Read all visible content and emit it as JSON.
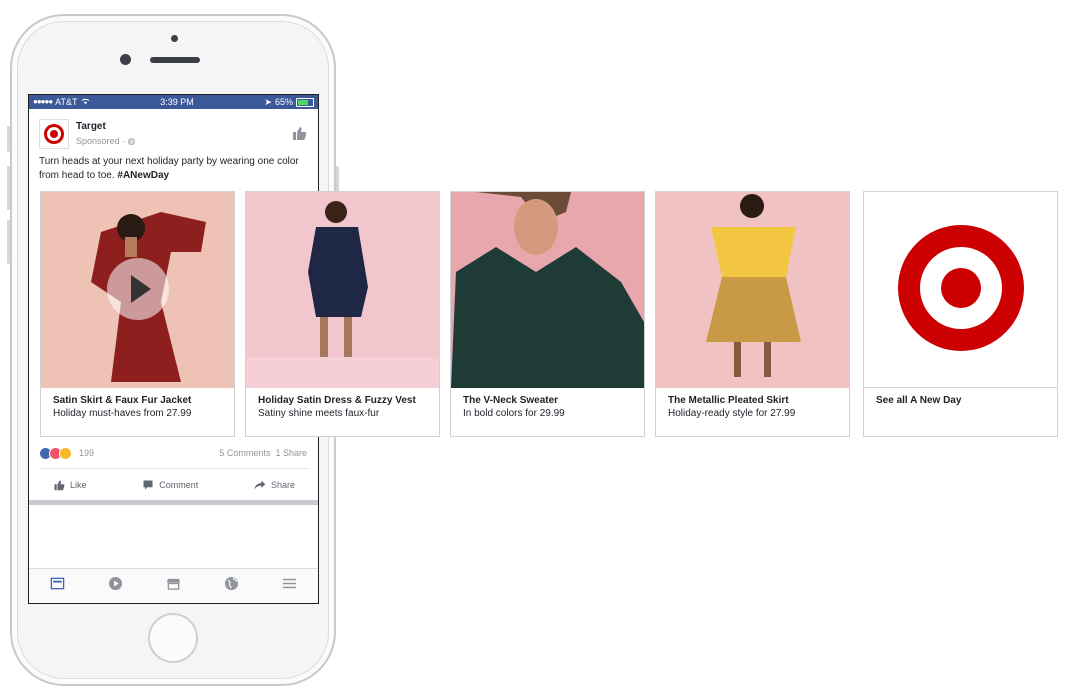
{
  "status_bar": {
    "carrier": "AT&T",
    "time": "3:39 PM",
    "battery": "65%"
  },
  "post": {
    "page_name": "Target",
    "sponsored": "Sponsored ·",
    "text_plain": "Turn heads at your next holiday party by wearing one color from head to toe. ",
    "hashtag": "#ANewDay",
    "reaction_count": "199",
    "comments": "5 Comments",
    "shares": "1 Share"
  },
  "actions": {
    "like": "Like",
    "comment": "Comment",
    "share": "Share"
  },
  "cards": [
    {
      "title": "Satin Skirt & Faux Fur Jacket",
      "subtitle": "Holiday must-haves from 27.99"
    },
    {
      "title": "Holiday Satin Dress & Fuzzy Vest",
      "subtitle": "Satiny shine meets faux-fur"
    },
    {
      "title": "The V-Neck Sweater",
      "subtitle": "In bold colors for 29.99"
    },
    {
      "title": "The Metallic Pleated Skirt",
      "subtitle": "Holiday-ready style for 27.99"
    },
    {
      "title": "See all A New Day",
      "subtitle": ""
    }
  ],
  "colors": {
    "facebook_blue": "#3b5998",
    "target_red": "#cc0000",
    "link_blue": "#4267b2"
  },
  "icons": [
    "thumbs-up-icon",
    "comment-icon",
    "share-icon",
    "news-feed-icon",
    "video-icon",
    "marketplace-icon",
    "globe-icon",
    "menu-icon",
    "play-icon"
  ]
}
